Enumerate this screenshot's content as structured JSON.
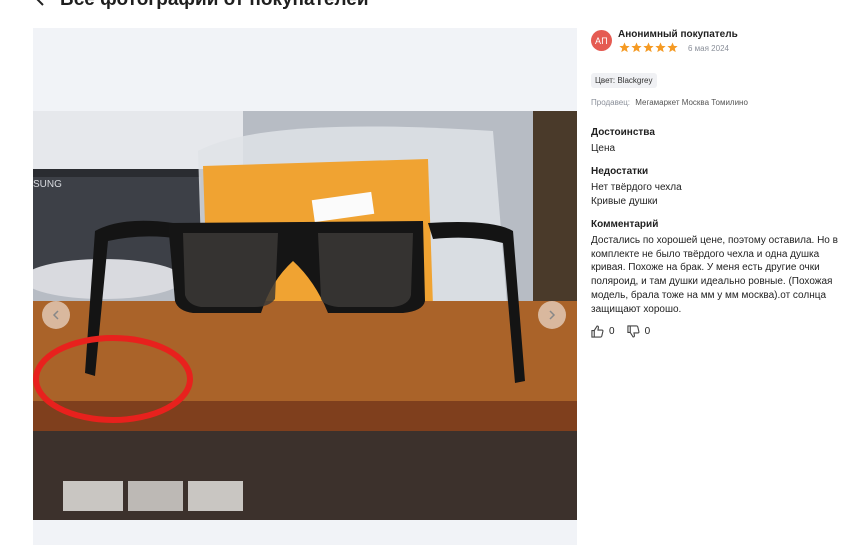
{
  "header": {
    "title": "Все фотографии от покупателей"
  },
  "review": {
    "avatar_initials": "АП",
    "author": "Анонимный покупатель",
    "rating": 5,
    "date": "6 мая 2024",
    "color_chip": "Цвет: Blackgrey",
    "seller_label": "Продавец:",
    "seller_name": "Мегамаркет Москва Томилино",
    "pros_title": "Достоинства",
    "pros_text": "Цена",
    "cons_title": "Недостатки",
    "cons_lines": [
      "Нет твёрдого чехла",
      "Кривые душки"
    ],
    "comment_title": "Комментарий",
    "comment_text": "Достались по хорошей цене, поэтому оставила. Но в комплекте не было твёрдого чехла и одна душка кривая. Похоже на брак. У меня есть другие очки поляроид, и там душки идеально ровные. (Похожая модель, брала тоже на мм у мм москва).от солнца защищают хорошо.",
    "likes": "0",
    "dislikes": "0"
  },
  "photo": {
    "monitor_text": "SUNG"
  },
  "colors": {
    "star": "#f59a23",
    "avatar": "#e55b52",
    "annotation": "#e8211d"
  },
  "icons": [
    "chevron-left-icon",
    "star-icon",
    "thumbs-up-icon",
    "thumbs-down-icon",
    "arrow-left-icon",
    "arrow-right-icon"
  ]
}
